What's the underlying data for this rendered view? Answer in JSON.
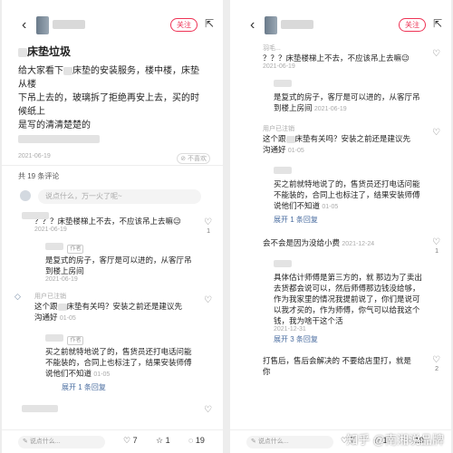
{
  "left": {
    "follow_label": "关注",
    "title": "床垫垃圾",
    "body_line1": "给大家看下",
    "body_line1b": "床垫的安装服务，楼中楼，床垫从楼",
    "body_line2": "下吊上去的，玻璃拆了拒绝再安上去，买的时候纸上",
    "body_line3": "是写的清清楚楚的",
    "date": "2021-06-19",
    "unlike": "不喜欢",
    "comment_count": "共 19 条评论",
    "input_placeholder": "说点什么，万一火了呢~",
    "comment1_text": "？？？床垫楼梯上不去，不应该吊上去嘛😉",
    "comment1_time": "2021-06-19",
    "comment1_likes": "1",
    "reply1_tag": "作者",
    "reply1_text": "是复式的房子，客厅是可以进的，从客厅吊到楼上房间",
    "reply1_time": "2021-06-19",
    "comment2_name": "用户已注销",
    "comment2_text": "这个跟",
    "comment2_text_b": "床垫有关吗？安装之前还是建议先沟通好",
    "comment2_time": "01-05",
    "reply2_tag": "作者",
    "reply2_text": "买之前就特地说了的，售货员还打电话问能不能装的，合同上也标注了，结果安装师傅说他们不知道",
    "reply2_time": "01-05",
    "expand_label": "展开 1 条回复",
    "bottom_input": "说点什么...",
    "likes": "7",
    "stars": "1",
    "comments": "19"
  },
  "right": {
    "follow_label": "关注",
    "top_name": "羽毛...",
    "c1_text": "？？？床垫楼梯上不去，不应该吊上去嘛😉",
    "c1_time": "2021-06-19",
    "r1_text": "是复式的房子，客厅是可以进的，从客厅吊到楼上房间",
    "r1_time": "2021-06-19",
    "c2_name": "用户已注销",
    "c2_text": "这个跟",
    "c2_text_b": "床垫有关吗？安装之前还是建议先沟通好",
    "c2_time": "01-05",
    "r2_text": "买之前就特地说了的，售货员还打电话问能不能装的，合同上也标注了，结果安装师傅说他们不知道",
    "r2_time": "01-05",
    "expand1": "展开 1 条回复",
    "c3_text": "会不会是因为没给小费",
    "c3_time": "2021-12-24",
    "c3_likes": "1",
    "r3_text": "具体估计师傅是第三方的，就  那边为了卖出去货都会说可以，然后师傅那边钱没给够，作为我家里的情况我提前说了，你们是说可以我才买的，作为师傅，你气可以给我这个钱，我为啥干这个活",
    "r3_time": "2021-12-31",
    "expand2": "展开 3 条回复",
    "c4_text": "打售后，售后会解决的 不要给店里打，就是你",
    "c4_likes": "2",
    "bottom_input": "说点什么...",
    "likes": "7",
    "stars": "1",
    "comments": "19",
    "watermark": "知乎 @南湘说品牌"
  }
}
